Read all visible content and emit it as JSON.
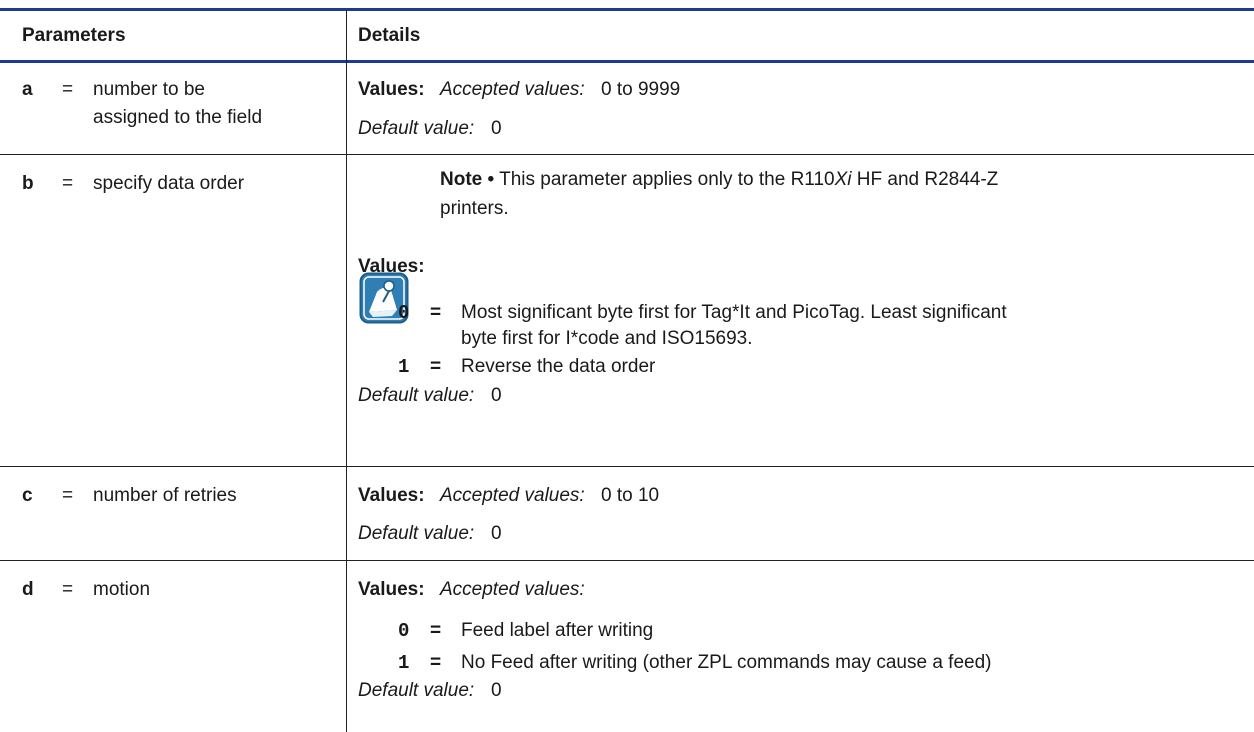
{
  "header": {
    "parameters": "Parameters",
    "details": "Details"
  },
  "rows": {
    "a": {
      "letter": "a",
      "eq": "=",
      "desc1": "number to be",
      "desc2": "assigned to the field",
      "values_label": "Values:",
      "accepted_label": "Accepted values:",
      "accepted_value": "0 to 9999",
      "default_label": "Default value:",
      "default_value": "0"
    },
    "b": {
      "letter": "b",
      "eq": "=",
      "desc": "specify data order",
      "note_label": "Note •",
      "note_pre": "This parameter applies only to the R110",
      "note_model_suffix": "Xi",
      "note_post": "HF and R2844-Z",
      "note_line2": "printers.",
      "note_icon": "note-pencil-icon",
      "values_label": "Values:",
      "options": [
        {
          "code": "0",
          "eq": "=",
          "line1": "Most significant byte first for Tag*It and PicoTag. Least significant",
          "line2": "byte first for I*code and ISO15693."
        },
        {
          "code": "1",
          "eq": "=",
          "line1": "Reverse the data order"
        }
      ],
      "default_label": "Default value:",
      "default_value": "0"
    },
    "c": {
      "letter": "c",
      "eq": "=",
      "desc": "number of retries",
      "values_label": "Values:",
      "accepted_label": "Accepted values:",
      "accepted_value": "0 to 10",
      "default_label": "Default value:",
      "default_value": "0"
    },
    "d": {
      "letter": "d",
      "eq": "=",
      "desc": "motion",
      "values_label": "Values:",
      "accepted_label": "Accepted values:",
      "options": [
        {
          "code": "0",
          "eq": "=",
          "line1": "Feed label after writing"
        },
        {
          "code": "1",
          "eq": "=",
          "line1": "No Feed after writing (other ZPL commands may cause a feed)"
        }
      ],
      "default_label": "Default value:",
      "default_value": "0"
    }
  },
  "colors": {
    "rule": "#1f3a93",
    "icon": "#2f7fb4"
  }
}
